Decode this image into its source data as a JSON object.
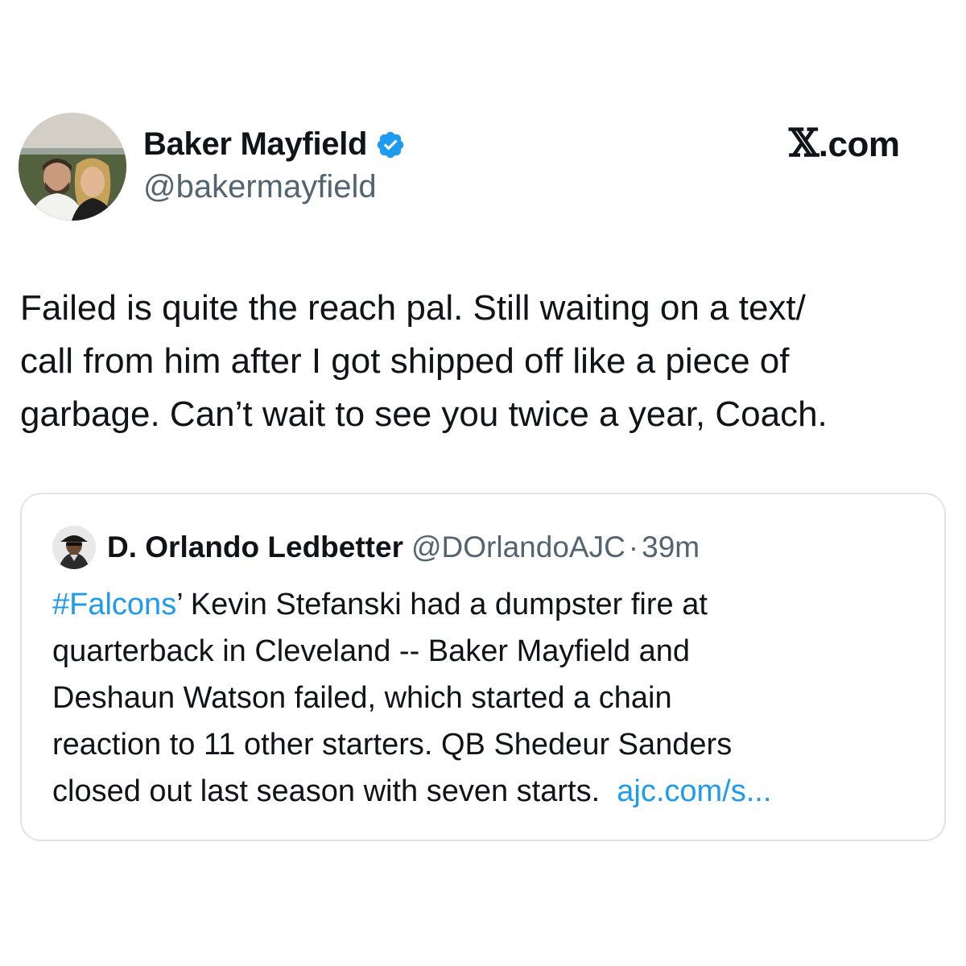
{
  "author": {
    "display_name": "Baker Mayfield",
    "handle": "@bakermayfield",
    "verified": true,
    "avatar_icon": "profile-photo-couple"
  },
  "brand": {
    "x_letter": "𝕏",
    "suffix": ".com"
  },
  "tweet": {
    "lines": [
      "Failed is quite the reach pal. Still waiting on a text/",
      "call from him after I got shipped off like a piece of",
      "garbage. Can’t wait to see you twice a year, Coach."
    ]
  },
  "quoted": {
    "display_name": "D. Orlando Ledbetter",
    "handle": "@DOrlandoAJC",
    "separator": "·",
    "time": "39m",
    "avatar_icon": "profile-photo-man-cap",
    "hashtag": "#Falcons",
    "line1_rest": "’ Kevin Stefanski had a dumpster fire at",
    "line2": "quarterback in Cleveland -- Baker Mayfield and",
    "line3": "Deshaun Watson failed, which started a chain",
    "line4": "reaction to 11 other starters. QB Shedeur Sanders",
    "line5_text": "closed out last season with seven starts.",
    "link_text": "ajc.com/s..."
  },
  "colors": {
    "text": "#0f1419",
    "secondary": "#536471",
    "link": "#1d9bf0",
    "border": "#e1e4e7",
    "verified": "#1d9bf0"
  }
}
